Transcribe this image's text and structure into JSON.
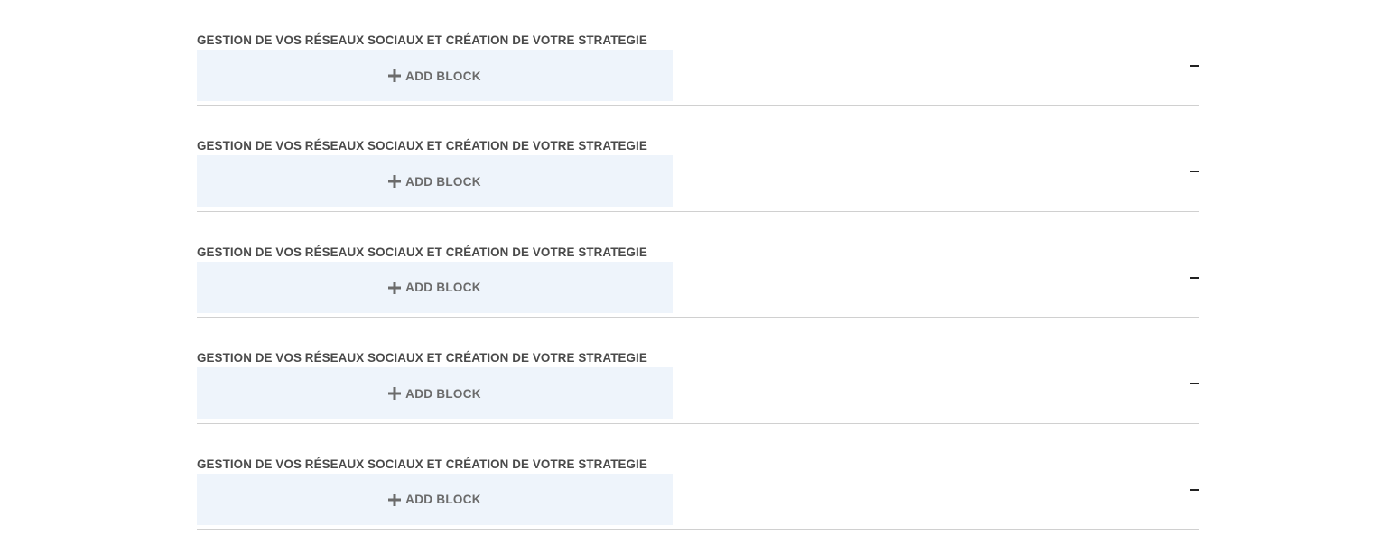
{
  "accordion": {
    "items": [
      {
        "title": "GESTION DE VOS RÉSEAUX SOCIAUX ET CRÉATION DE VOTRE STRATEGIE",
        "add_block_label": "ADD BLOCK",
        "add_icon": "plus-icon",
        "toggle_icon": "minus-icon",
        "expanded": true
      },
      {
        "title": "GESTION DE VOS RÉSEAUX SOCIAUX ET CRÉATION DE VOTRE STRATEGIE",
        "add_block_label": "ADD BLOCK",
        "add_icon": "plus-icon",
        "toggle_icon": "minus-icon",
        "expanded": true
      },
      {
        "title": "GESTION DE VOS RÉSEAUX SOCIAUX ET CRÉATION DE VOTRE STRATEGIE",
        "add_block_label": "ADD BLOCK",
        "add_icon": "plus-icon",
        "toggle_icon": "minus-icon",
        "expanded": true
      },
      {
        "title": "GESTION DE VOS RÉSEAUX SOCIAUX ET CRÉATION DE VOTRE STRATEGIE",
        "add_block_label": "ADD BLOCK",
        "add_icon": "plus-icon",
        "toggle_icon": "minus-icon",
        "expanded": true
      },
      {
        "title": "GESTION DE VOS RÉSEAUX SOCIAUX ET CRÉATION DE VOTRE STRATEGIE",
        "add_block_label": "ADD BLOCK",
        "add_icon": "plus-icon",
        "toggle_icon": "minus-icon",
        "expanded": true
      }
    ]
  },
  "colors": {
    "title_text": "#4a4a4a",
    "add_block_bg": "#eef4fb",
    "add_block_text": "#6b6b6b",
    "divider": "#d0d0d0",
    "toggle_icon": "#222222"
  }
}
